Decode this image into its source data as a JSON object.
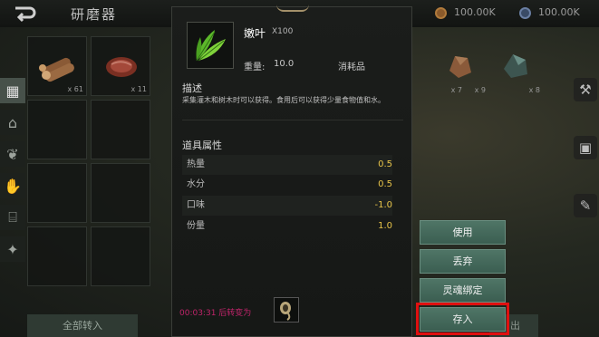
{
  "header": {
    "back_icon": "back-arrow-icon",
    "title": "研磨器",
    "currencies": [
      {
        "icon": "bronze-coin-icon",
        "amount": "100.00K",
        "color": "#8b5a2b"
      },
      {
        "icon": "blue-gem-icon",
        "amount": "100.00K",
        "color": "#3a4b66"
      }
    ]
  },
  "side_tabs": [
    {
      "icon": "grid-icon",
      "active": true
    },
    {
      "icon": "building-icon",
      "active": false
    },
    {
      "icon": "leaf-icon",
      "active": false
    },
    {
      "icon": "hand-icon",
      "active": false
    },
    {
      "icon": "bank-icon",
      "active": false
    },
    {
      "icon": "wolf-icon",
      "active": false
    }
  ],
  "inventory": {
    "slots": [
      {
        "item": "wood-logs",
        "qty": "x 61"
      },
      {
        "item": "raw-meat",
        "qty": "x 11"
      }
    ],
    "right_slots": [
      {
        "qty": "x 7"
      },
      {
        "item": "brown-ore",
        "qty": "x 9"
      },
      {
        "item": "green-ore",
        "qty": "x 8"
      }
    ],
    "transfer_all_label": "全部转入",
    "store_hint_suffix": "出"
  },
  "right_icons": [
    "anvil-icon",
    "chest-icon",
    "scroll-icon"
  ],
  "item_detail": {
    "icon": "tender-leaf-icon",
    "name": "嫩叶",
    "count": "X100",
    "weight_label": "重量:",
    "weight_value": "10.0",
    "type": "消耗品",
    "description_title": "描述",
    "description": "采集灌木和树木时可以获得。食用后可以获得少量食物值和水。",
    "attributes_title": "道具属性",
    "attributes": [
      {
        "name": "热量",
        "value": "0.5"
      },
      {
        "name": "水分",
        "value": "0.5"
      },
      {
        "name": "口味",
        "value": "-1.0"
      },
      {
        "name": "份量",
        "value": "1.0"
      }
    ],
    "timer_text": "00:03:31 后转变为",
    "transform_icon": "seed-pod-icon"
  },
  "actions": {
    "use": "使用",
    "discard": "丢弃",
    "soulbind": "灵魂绑定",
    "deposit": "存入"
  },
  "colors": {
    "accent_button": "#4f7566",
    "attr_value": "#e8c449",
    "timer": "#c0246a",
    "highlight": "#e01010"
  }
}
